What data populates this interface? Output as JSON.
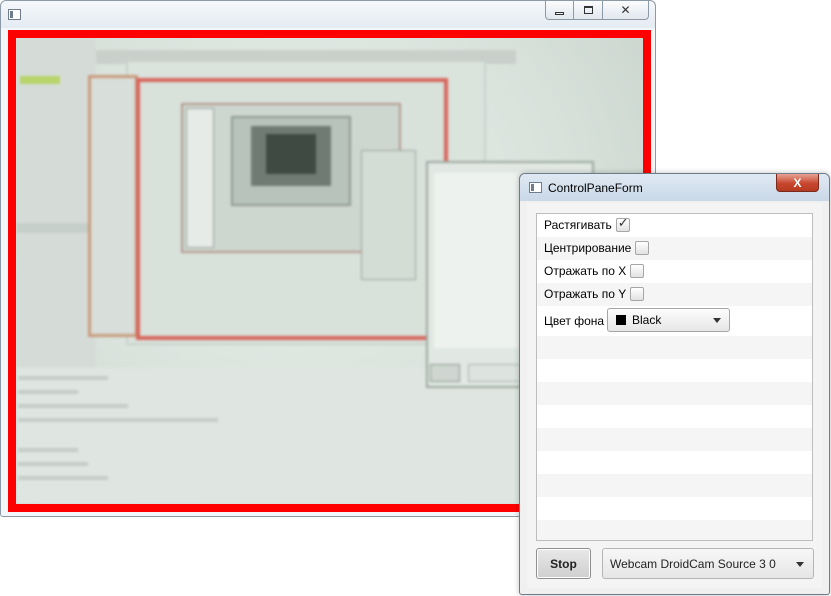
{
  "main_window": {
    "icons": {
      "app": "window-app-icon",
      "minimize": "minimize-icon",
      "maximize": "maximize-icon",
      "close": "close-icon"
    },
    "border_color": "#ff0000"
  },
  "control_window": {
    "title": "ControlPaneForm",
    "options": [
      {
        "label": "Растягивать",
        "checked": true
      },
      {
        "label": "Центрирование",
        "checked": false
      },
      {
        "label": "Отражать по X",
        "checked": false
      },
      {
        "label": "Отражать по Y",
        "checked": false
      }
    ],
    "background_color": {
      "label": "Цвет фона",
      "value": "Black",
      "swatch": "#000000"
    },
    "stop_label": "Stop",
    "source_value": "Webcam DroidCam Source 3 0",
    "close_glyph": "X"
  }
}
